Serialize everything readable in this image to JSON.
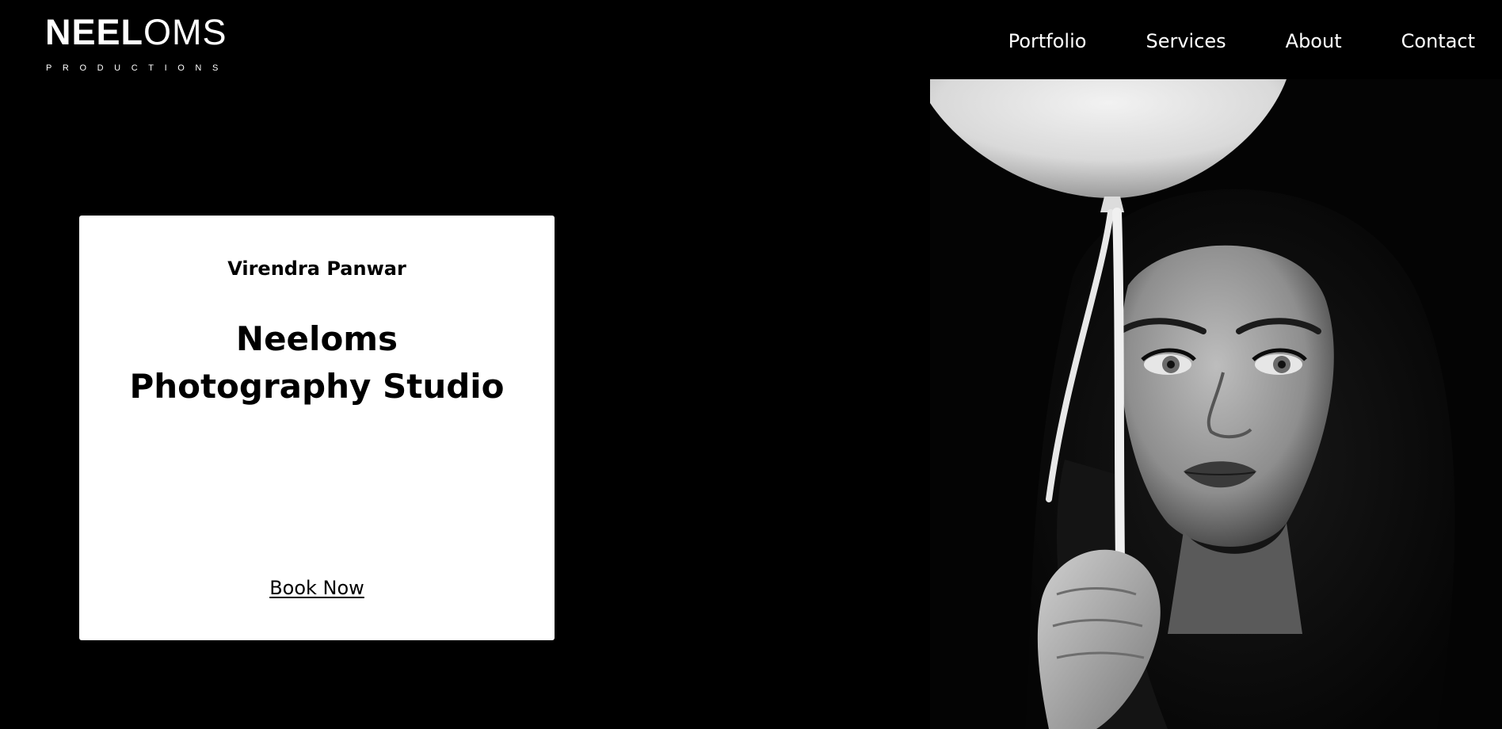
{
  "logo": {
    "bold_text": "NEEL",
    "light_text": "OMS",
    "sub_text": "PRODUCTIONS"
  },
  "nav": {
    "items": [
      {
        "label": "Portfolio"
      },
      {
        "label": "Services"
      },
      {
        "label": "About"
      },
      {
        "label": "Contact"
      }
    ]
  },
  "card": {
    "name": "Virendra Panwar",
    "title_line1": "Neeloms",
    "title_line2": "Photography Studio",
    "cta": "Book Now"
  },
  "colors": {
    "background": "#000000",
    "card_background": "#ffffff",
    "text_on_dark": "#ffffff",
    "text_on_light": "#000000"
  }
}
